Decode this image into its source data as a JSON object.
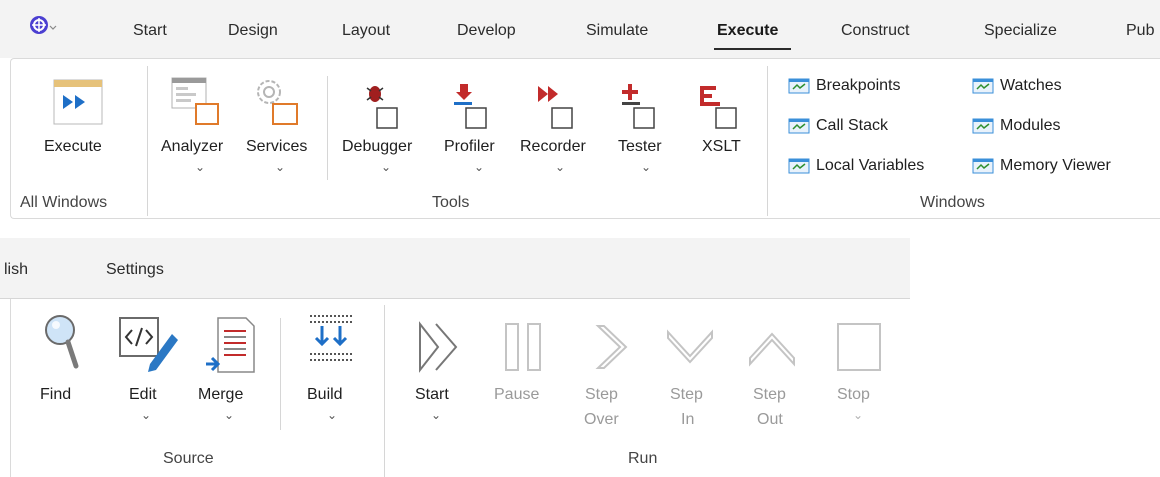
{
  "top_tabs": [
    "Start",
    "Design",
    "Layout",
    "Develop",
    "Simulate",
    "Execute",
    "Construct",
    "Specialize",
    "Pub"
  ],
  "active_tab": "Execute",
  "all_windows": {
    "execute_label": "Execute",
    "group_label": "All Windows"
  },
  "tools": {
    "items": [
      "Analyzer",
      "Services",
      "Debugger",
      "Profiler",
      "Recorder",
      "Tester",
      "XSLT"
    ],
    "group_label": "Tools"
  },
  "windows": {
    "items": [
      "Breakpoints",
      "Call Stack",
      "Local Variables",
      "Watches",
      "Modules",
      "Memory Viewer"
    ],
    "group_label": "Windows"
  },
  "bottom_tabs": [
    "lish",
    "Settings"
  ],
  "source": {
    "items": [
      "Find",
      "Edit",
      "Merge",
      "Build"
    ],
    "group_label": "Source"
  },
  "run": {
    "start_label": "Start",
    "pause_label": "Pause",
    "step_over": [
      "Step",
      "Over"
    ],
    "step_in": [
      "Step",
      "In"
    ],
    "step_out": [
      "Step",
      "Out"
    ],
    "stop_label": "Stop",
    "group_label": "Run"
  },
  "colors": {
    "accent_blue": "#3a8fd9",
    "orange": "#e07a2a",
    "red": "#c22b2b",
    "disabled": "#9a9a9a"
  }
}
